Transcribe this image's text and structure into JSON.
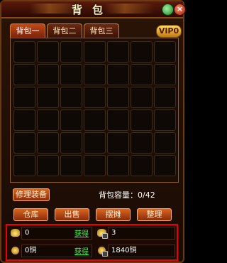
{
  "window": {
    "title": "背包"
  },
  "tabs": [
    {
      "label": "背包一"
    },
    {
      "label": "背包二"
    },
    {
      "label": "背包三"
    }
  ],
  "vip": {
    "label": "VIP0"
  },
  "grid": {
    "rows": 6,
    "cols": 7,
    "slots": []
  },
  "repair_button": {
    "label": "修理装备"
  },
  "capacity": {
    "text": "背包容量：0/42"
  },
  "actions": [
    {
      "label": "仓库"
    },
    {
      "label": "出售"
    },
    {
      "label": "摆摊"
    },
    {
      "label": "整理"
    }
  ],
  "currency": {
    "ingot": {
      "value": "0",
      "link": "获得"
    },
    "bound_ingot": {
      "value": "3"
    },
    "copper": {
      "value": "0铜",
      "link": "获得"
    },
    "bound_copper": {
      "value": "1840铜"
    }
  },
  "colors": {
    "highlight_border": "#e00000",
    "link_green": "#3dff3d"
  }
}
